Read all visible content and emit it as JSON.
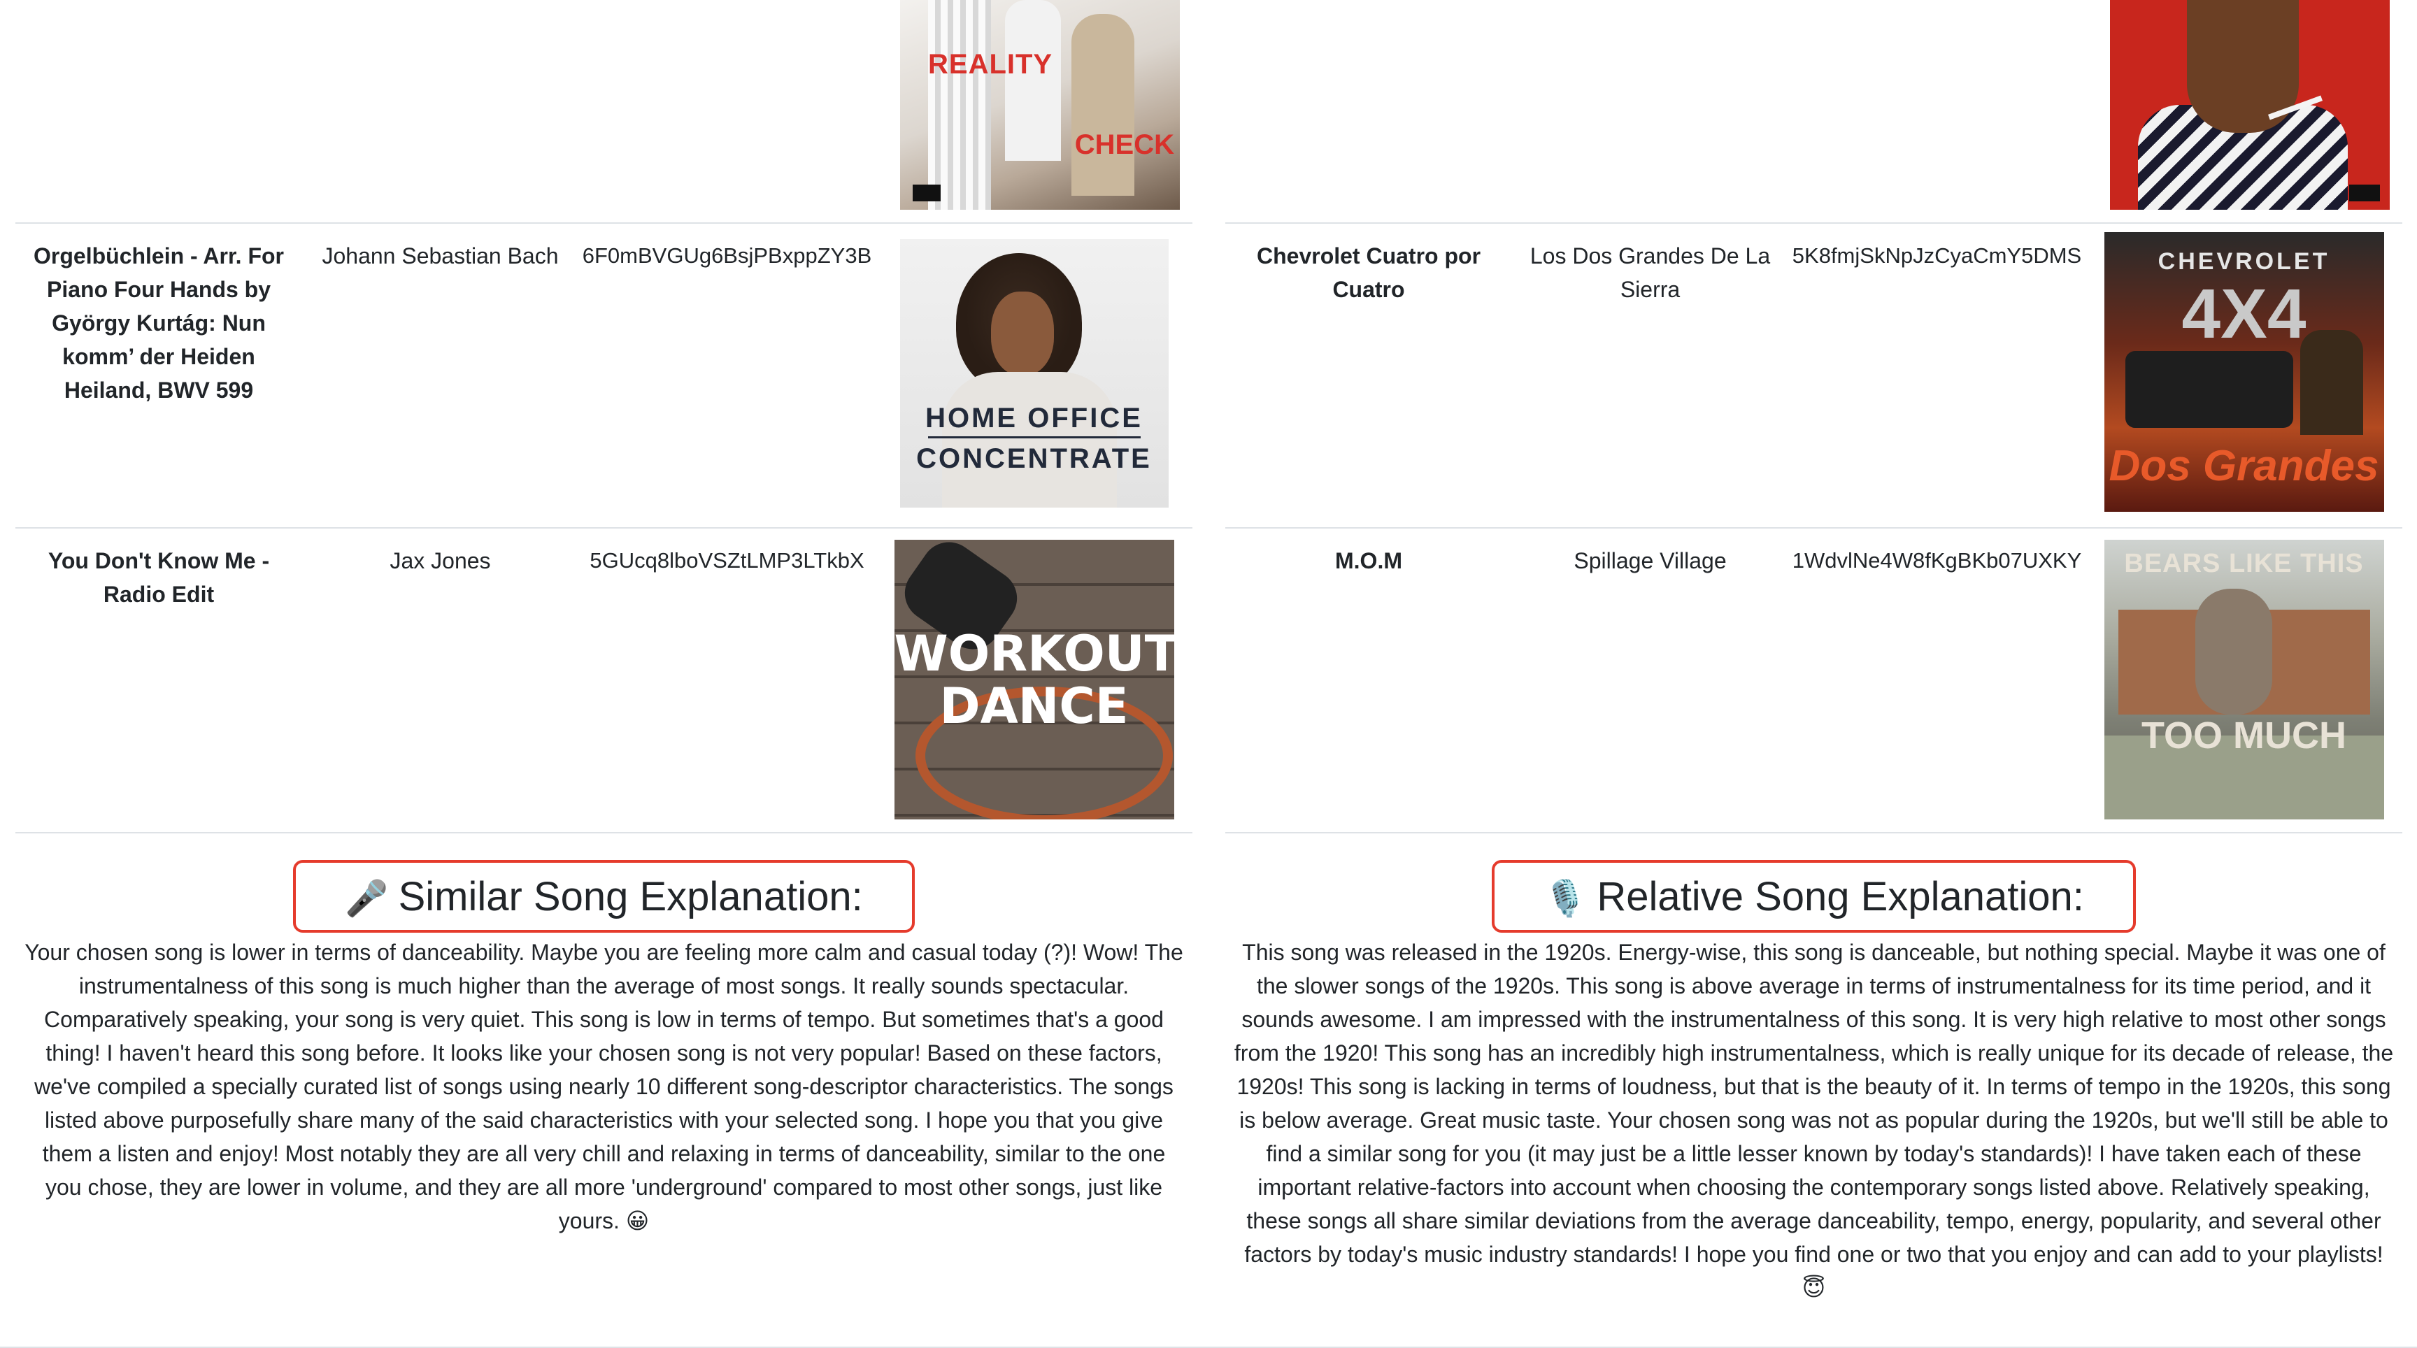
{
  "left": {
    "rows": [
      {
        "title": "",
        "artist": "",
        "id": "",
        "cover": {
          "text_top": "REALITY",
          "text_bottom": "CHECK",
          "bg": "#e9e6e2"
        }
      },
      {
        "title": "Orgelbüchlein - Arr. For Piano Four Hands by György Kurtág: Nun komm’ der Heiden Heiland, BWV 599",
        "artist": "Johann Sebastian Bach",
        "id": "6F0mBVGUg6BsjPBxppZY3B",
        "cover": {
          "line1": "HOME OFFICE",
          "line2": "CONCENTRATE",
          "bg": "#ececec"
        }
      },
      {
        "title": "You Don't Know Me - Radio Edit",
        "artist": "Jax Jones",
        "id": "5GUcq8lboVSZtLMP3LTkbX",
        "cover": {
          "line1": "WORKOUT",
          "line2": "DANCE",
          "bg": "#5b4f46"
        }
      }
    ],
    "explanation": {
      "emoji": "🎤",
      "heading": "Similar Song Explanation:",
      "text": "Your chosen song is lower in terms of danceability. Maybe you are feeling more calm and casual today (?)! Wow! The instrumentalness of this song is much higher than the average of most songs. It really sounds spectacular. Comparatively speaking, your song is very quiet. This song is low in terms of tempo. But sometimes that's a good thing! I haven't heard this song before. It looks like your chosen song is not very popular! Based on these factors, we've compiled a specially curated list of songs using nearly 10 different song-descriptor characteristics. The songs listed above purposefully share many of the said characteristics with your selected song. I hope you that you give them a listen and enjoy! Most notably they are all very chill and relaxing in terms of danceability, similar to the one you chose, they are lower in volume, and they are all more 'underground' compared to most other songs, just like yours. 😀"
    }
  },
  "right": {
    "rows": [
      {
        "title": "",
        "artist": "",
        "id": "",
        "cover": {
          "bg": "#c8261d"
        }
      },
      {
        "title": "Chevrolet Cuatro por Cuatro",
        "artist": "Los Dos Grandes De La Sierra",
        "id": "5K8fmjSkNpJzCyaCmY5DMS",
        "cover": {
          "line1": "CHEVROLET",
          "line2": "4X4",
          "line3": "Dos Grandes",
          "bg": "#7a2a1a"
        }
      },
      {
        "title": "M.O.M",
        "artist": "Spillage Village",
        "id": "1WdvlNe4W8fKgBKb07UXKY",
        "cover": {
          "line1": "BEARS LIKE THIS",
          "line2": "TOO MUCH",
          "bg": "#8d8f86"
        }
      }
    ],
    "explanation": {
      "emoji": "🎙️",
      "heading": "Relative Song Explanation:",
      "text": "This song was released in the 1920s. Energy-wise, this song is danceable, but nothing special. Maybe it was one of the slower songs of the 1920s. This song is above average in terms of instrumentalness for its time period, and it sounds awesome. I am impressed with the instrumentalness of this song. It is very high relative to most other songs from the 1920! This song has an incredibly high instrumentalness, which is really unique for its decade of release, the 1920s! This song is lacking in terms of loudness, but that is the beauty of it. In terms of tempo in the 1920s, this song is below average. Great music taste. Your chosen song was not as popular during the 1920s, but we'll still be able to find a similar song for you (it may just be a little lesser known by today's standards)! I have taken each of these important relative-factors into account when choosing the contemporary songs listed above. Relatively speaking, these songs all share similar deviations from the average danceability, tempo, energy, popularity, and several other factors by today's music industry standards! I hope you find one or two that you enjoy and can add to your playlists! 😇"
    }
  }
}
